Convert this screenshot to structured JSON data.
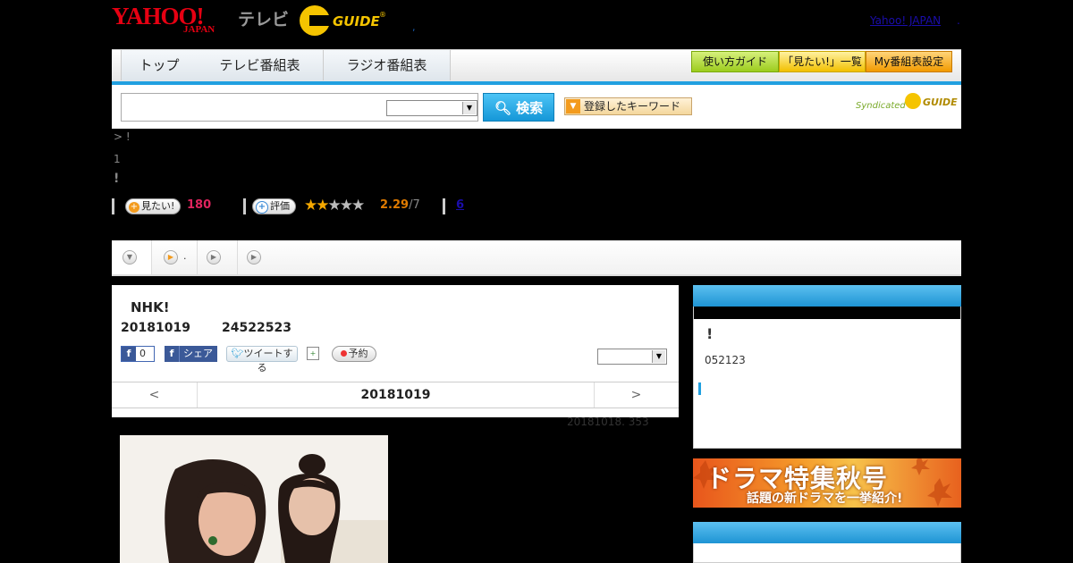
{
  "header": {
    "logo_yahoo": "YAHOO!",
    "logo_japan": "JAPAN",
    "logo_tv": "テレビ",
    "logo_guide": "GUIDE",
    "logo_reg": "®",
    "separator": ",",
    "yahoo_japan_link": "Yahoo! JAPAN",
    "trailing_dot": "."
  },
  "nav": {
    "tabs": [
      {
        "label": "トップ"
      },
      {
        "label": "テレビ番組表"
      },
      {
        "label": "ラジオ番組表"
      }
    ],
    "guide_button": "使い方ガイド",
    "mitai_list_button": "「見たい!」一覧",
    "my_schedule_button": "My番組表設定"
  },
  "search": {
    "input_value": "",
    "select_value": "",
    "button_label": "検索",
    "keyword_button": "登録したキーワード",
    "syndicated_label": "Syndicated",
    "syndicated_brand": "GUIDE"
  },
  "breadcrumb": "> !",
  "line_small": "1",
  "line_bang": "!",
  "stats": {
    "want_label": "見たい!",
    "want_count": "180",
    "rate_label": "評価",
    "rating_value": "2.29",
    "rating_total": "/7",
    "stars_on": 2,
    "stars_total": 5,
    "link_count": "6"
  },
  "view_tabs": [
    {
      "label": ""
    },
    {
      "label": "."
    },
    {
      "label": ""
    },
    {
      "label": ""
    }
  ],
  "program": {
    "title": "NHK!",
    "date": "20181019",
    "time": "24522523",
    "fb_like_count": "0",
    "fb_share_label": "シェア",
    "tweet_label": "ツイートする",
    "reserve_label": "予約",
    "select_value": "",
    "prev_label": "<",
    "current_date": "20181019",
    "next_label": ">",
    "meta_text": "20181018. 353"
  },
  "sidebar": {
    "box1_bang": "!",
    "box1_numbers": "052123",
    "banner_title": "ドラマ特集秋号",
    "banner_subtitle": "話題の新ドラマを一挙紹介!"
  }
}
